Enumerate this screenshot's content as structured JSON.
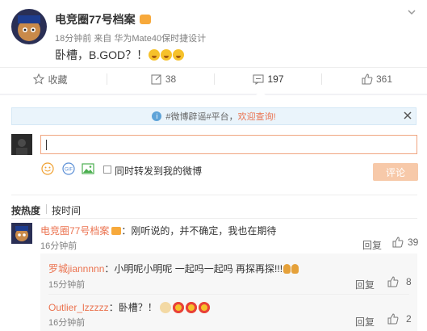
{
  "post": {
    "author": "电竞圈77号档案",
    "time": "18分钟前",
    "source_prefix": "来自",
    "source": "华为Mate40保时捷设计",
    "text": "卧槽，B.GOD？！",
    "emojis": [
      "shock-face",
      "shock-face",
      "shock-face"
    ]
  },
  "actions": {
    "collect": "收藏",
    "forward": "38",
    "comment": "197",
    "like": "361"
  },
  "notice": {
    "text": "#微博辟谣#平台，",
    "link": "欢迎查询!"
  },
  "composer": {
    "input_value": "",
    "sync_label": "同时转发到我的微博",
    "post_label": "评论"
  },
  "sort": {
    "hot": "按热度",
    "time": "按时间"
  },
  "comments": [
    {
      "author": "电竞圈77号档案",
      "text": "：刚听说的，并不确定，我也在期待",
      "time": "16分钟前",
      "reply_label": "回复",
      "likes": "39"
    }
  ],
  "replies": [
    {
      "author": "罗城jiannnnn",
      "text": "：小明呢小明呢 一起吗一起吗 再探再探!!!",
      "time": "15分钟前",
      "reply_label": "回复",
      "likes": "8"
    },
    {
      "author": "Outlier_lzzzzz",
      "text": "：卧槽？！",
      "time": "16分钟前",
      "reply_label": "回复",
      "likes": "2"
    }
  ],
  "colors": {
    "accent": "#eb7350",
    "notice_bg": "#eaf4fb"
  }
}
